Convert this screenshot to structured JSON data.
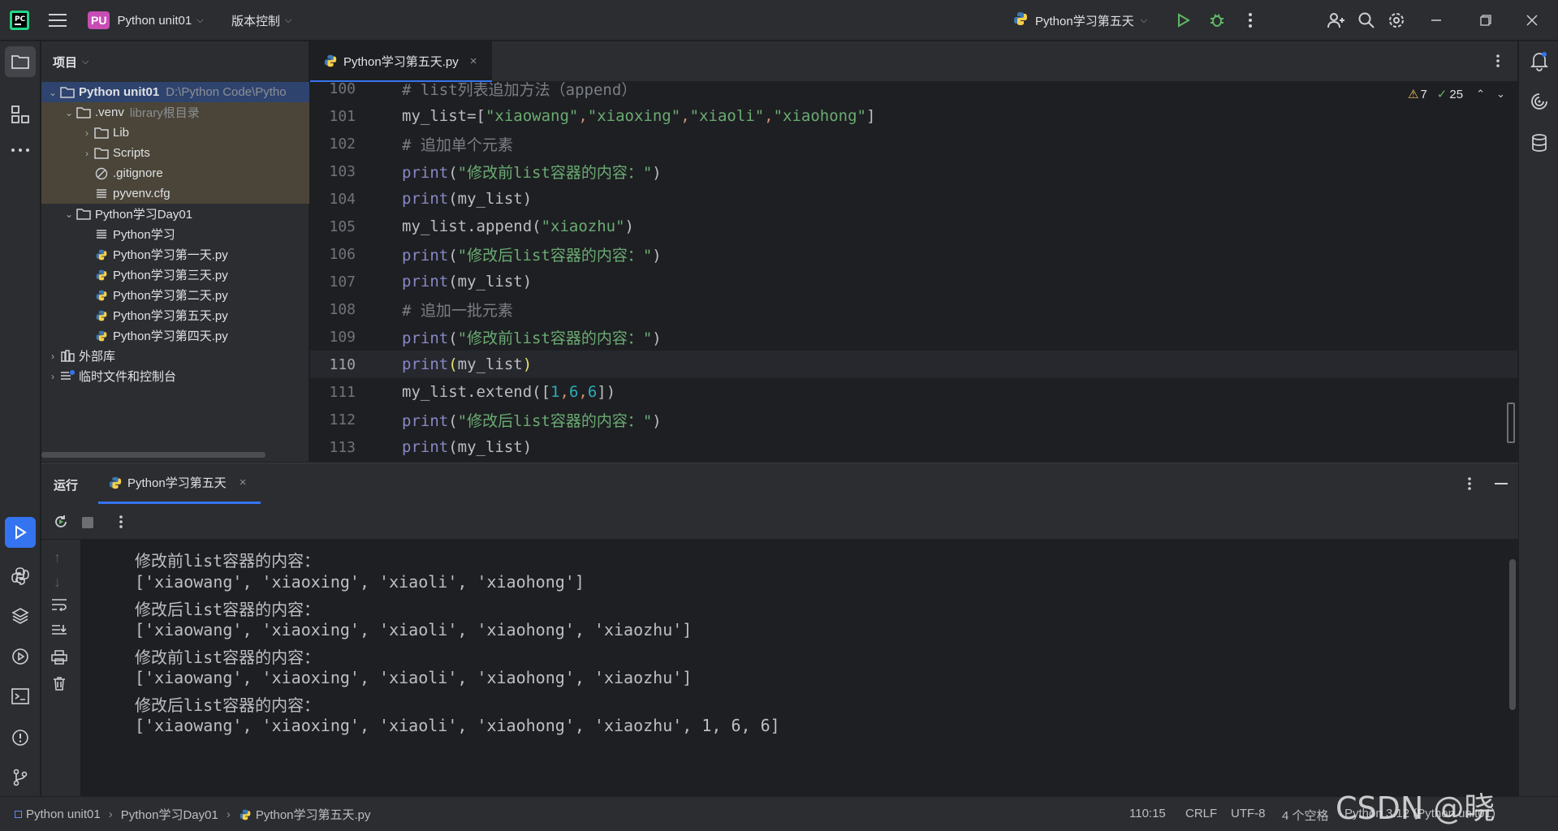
{
  "titlebar": {
    "project_badge": "PU",
    "project_name": "Python unit01",
    "vcs_label": "版本控制",
    "run_config": "Python学习第五天"
  },
  "project_panel": {
    "title": "项目",
    "items": [
      {
        "label": "Python unit01",
        "hint": "D:\\Python Code\\Pytho"
      },
      {
        "label": ".venv",
        "hint": "library根目录"
      },
      {
        "label": "Lib"
      },
      {
        "label": "Scripts"
      },
      {
        "label": ".gitignore"
      },
      {
        "label": "pyvenv.cfg"
      },
      {
        "label": "Python学习Day01"
      },
      {
        "label": "Python学习"
      },
      {
        "label": "Python学习第一天.py"
      },
      {
        "label": "Python学习第三天.py"
      },
      {
        "label": "Python学习第二天.py"
      },
      {
        "label": "Python学习第五天.py"
      },
      {
        "label": "Python学习第四天.py"
      },
      {
        "label": "外部库"
      },
      {
        "label": "临时文件和控制台"
      }
    ]
  },
  "editor": {
    "tab_label": "Python学习第五天.py",
    "warnings": "7",
    "checks": "25",
    "lines": [
      {
        "no": "100",
        "parts": [
          {
            "t": "# list列表追加方法（append）",
            "c": "#7a7e85"
          }
        ]
      },
      {
        "no": "101",
        "parts": [
          {
            "t": "my_list=[",
            "c": "#bcbec4"
          },
          {
            "t": "\"xiaowang\"",
            "c": "#6aab73"
          },
          {
            "t": ",",
            "c": "#cf8e6d"
          },
          {
            "t": "\"xiaoxing\"",
            "c": "#6aab73"
          },
          {
            "t": ",",
            "c": "#cf8e6d"
          },
          {
            "t": "\"xiaoli\"",
            "c": "#6aab73"
          },
          {
            "t": ",",
            "c": "#cf8e6d"
          },
          {
            "t": "\"xiaohong\"",
            "c": "#6aab73"
          },
          {
            "t": "]",
            "c": "#bcbec4"
          }
        ]
      },
      {
        "no": "102",
        "parts": [
          {
            "t": "# 追加单个元素",
            "c": "#7a7e85"
          }
        ]
      },
      {
        "no": "103",
        "parts": [
          {
            "t": "print",
            "c": "#8888c6"
          },
          {
            "t": "(",
            "c": "#bcbec4"
          },
          {
            "t": "\"修改前list容器的内容：\"",
            "c": "#6aab73"
          },
          {
            "t": ")",
            "c": "#bcbec4"
          }
        ]
      },
      {
        "no": "104",
        "parts": [
          {
            "t": "print",
            "c": "#8888c6"
          },
          {
            "t": "(my_list)",
            "c": "#bcbec4"
          }
        ]
      },
      {
        "no": "105",
        "parts": [
          {
            "t": "my_list.append(",
            "c": "#bcbec4"
          },
          {
            "t": "\"xiaozhu\"",
            "c": "#6aab73"
          },
          {
            "t": ")",
            "c": "#bcbec4"
          }
        ]
      },
      {
        "no": "106",
        "parts": [
          {
            "t": "print",
            "c": "#8888c6"
          },
          {
            "t": "(",
            "c": "#bcbec4"
          },
          {
            "t": "\"修改后list容器的内容：\"",
            "c": "#6aab73"
          },
          {
            "t": ")",
            "c": "#bcbec4"
          }
        ]
      },
      {
        "no": "107",
        "parts": [
          {
            "t": "print",
            "c": "#8888c6"
          },
          {
            "t": "(my_list)",
            "c": "#bcbec4"
          }
        ]
      },
      {
        "no": "108",
        "parts": [
          {
            "t": "# 追加一批元素",
            "c": "#7a7e85"
          }
        ]
      },
      {
        "no": "109",
        "parts": [
          {
            "t": "print",
            "c": "#8888c6"
          },
          {
            "t": "(",
            "c": "#bcbec4"
          },
          {
            "t": "\"修改前list容器的内容：\"",
            "c": "#6aab73"
          },
          {
            "t": ")",
            "c": "#bcbec4"
          }
        ]
      },
      {
        "no": "110",
        "parts": [
          {
            "t": "print",
            "c": "#8888c6"
          },
          {
            "t": "(",
            "c": "#e8e36a"
          },
          {
            "t": "my_list",
            "c": "#bcbec4"
          },
          {
            "t": ")",
            "c": "#e8e36a"
          }
        ]
      },
      {
        "no": "111",
        "parts": [
          {
            "t": "my_list.extend([",
            "c": "#bcbec4"
          },
          {
            "t": "1",
            "c": "#2aacb8"
          },
          {
            "t": ",",
            "c": "#cf8e6d"
          },
          {
            "t": "6",
            "c": "#2aacb8"
          },
          {
            "t": ",",
            "c": "#cf8e6d"
          },
          {
            "t": "6",
            "c": "#2aacb8"
          },
          {
            "t": "])",
            "c": "#bcbec4"
          }
        ]
      },
      {
        "no": "112",
        "parts": [
          {
            "t": "print",
            "c": "#8888c6"
          },
          {
            "t": "(",
            "c": "#bcbec4"
          },
          {
            "t": "\"修改后list容器的内容：\"",
            "c": "#6aab73"
          },
          {
            "t": ")",
            "c": "#bcbec4"
          }
        ]
      },
      {
        "no": "113",
        "parts": [
          {
            "t": "print",
            "c": "#8888c6"
          },
          {
            "t": "(my_list)",
            "c": "#bcbec4"
          }
        ]
      }
    ]
  },
  "run_panel": {
    "title": "运行",
    "tab_label": "Python学习第五天",
    "output": [
      "修改前list容器的内容：",
      "['xiaowang', 'xiaoxing', 'xiaoli', 'xiaohong']",
      "修改后list容器的内容：",
      "['xiaowang', 'xiaoxing', 'xiaoli', 'xiaohong', 'xiaozhu']",
      "修改前list容器的内容：",
      "['xiaowang', 'xiaoxing', 'xiaoli', 'xiaohong', 'xiaozhu']",
      "修改后list容器的内容：",
      "['xiaowang', 'xiaoxing', 'xiaoli', 'xiaohong', 'xiaozhu', 1, 6, 6]"
    ]
  },
  "statusbar": {
    "crumbs": [
      "Python unit01",
      "Python学习Day01",
      "Python学习第五天.py"
    ],
    "position": "110:15",
    "line_sep": "CRLF",
    "encoding": "UTF-8",
    "indent": "4 个空格",
    "interpreter": "Python 3.12 (Python unit01)"
  },
  "watermark": "CSDN @晓1313",
  "colors": {
    "accent": "#3574f0",
    "bg": "#1e1f22",
    "panel": "#2b2d30",
    "project_badge": "#c74db5",
    "run_green": "#5fb865"
  }
}
